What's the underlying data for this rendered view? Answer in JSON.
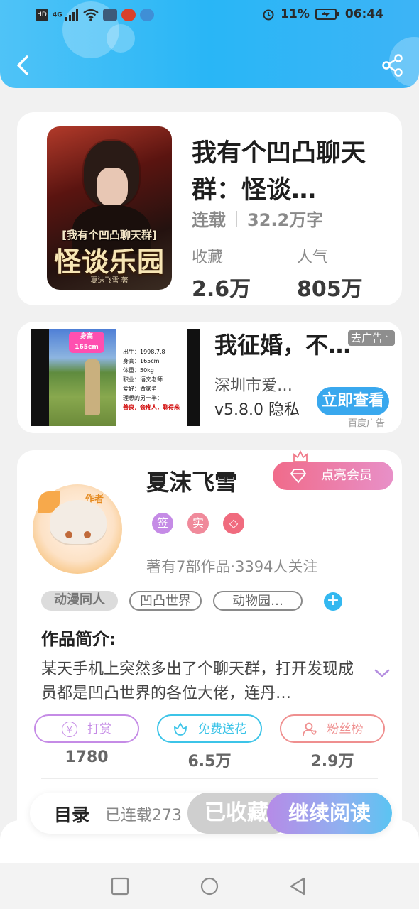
{
  "status_bar": {
    "left_icons": [
      "hd-icon",
      "4g-signal-icon",
      "wifi-icon",
      "app-notification-icon",
      "app-notification-icon-2",
      "app-notification-icon-3"
    ],
    "hd": "HD",
    "net": "4G",
    "battery_percent": "11%",
    "time": "06:44"
  },
  "header": {
    "back_icon": "chevron-left-icon",
    "share_icon": "share-icon"
  },
  "book": {
    "cover": {
      "subtitle": "[我有个凹凸聊天群]",
      "big_title": "怪谈乐园",
      "author_line": "夏沫飞雪 著"
    },
    "title": "我有个凹凸聊天群：怪谈…",
    "status": "连载",
    "word_count": "32.2万字",
    "favorites_label": "收藏",
    "favorites_value": "2.6万",
    "popularity_label": "人气",
    "popularity_value": "805万"
  },
  "ad": {
    "image_tag": "身高165cm",
    "image_info": [
      "出生：1998.7.8",
      "身高：165cm",
      "体重：50kg",
      "职业：语文老师",
      "爱好：做家务",
      "理想的另一半："
    ],
    "image_info_red": "善良，会疼人，聊得来",
    "title": "我征婚，不…",
    "close_label": "去广告",
    "company": "深圳市爱…",
    "version": "v5.8.0 隐私",
    "cta": "立即查看",
    "source": "百度广告"
  },
  "author": {
    "avatar_tag": "作者",
    "name": "夏沫飞雪",
    "vip_button": "点亮会员",
    "badges": [
      "签",
      "实",
      "◇"
    ],
    "works_info": "著有7部作品·3394人关注",
    "tags": [
      "动漫同人",
      "凹凸世界",
      "动物园…"
    ],
    "add_tag": "+",
    "intro_heading": "作品简介:",
    "intro_text": "某天手机上突然多出了个聊天群，打开发现成员都是凹凸世界的各位大佬，连丹…",
    "actions": [
      {
        "label": "打赏",
        "value": "1780",
        "icon": "yen-coin-icon",
        "color": "#c58be6"
      },
      {
        "label": "免费送花",
        "value": "6.5万",
        "icon": "flower-icon",
        "color": "#3cc4e8"
      },
      {
        "label": "粉丝榜",
        "value": "2.9万",
        "icon": "fan-user-icon",
        "color": "#ef8f8f"
      }
    ]
  },
  "bottom_bar": {
    "toc_label": "目录",
    "toc_count": "已连载273",
    "favorited_button": "已收藏",
    "continue_button": "继续阅读"
  },
  "nav": {
    "icons": [
      "recent-apps-icon",
      "home-icon",
      "back-triangle-icon"
    ]
  }
}
